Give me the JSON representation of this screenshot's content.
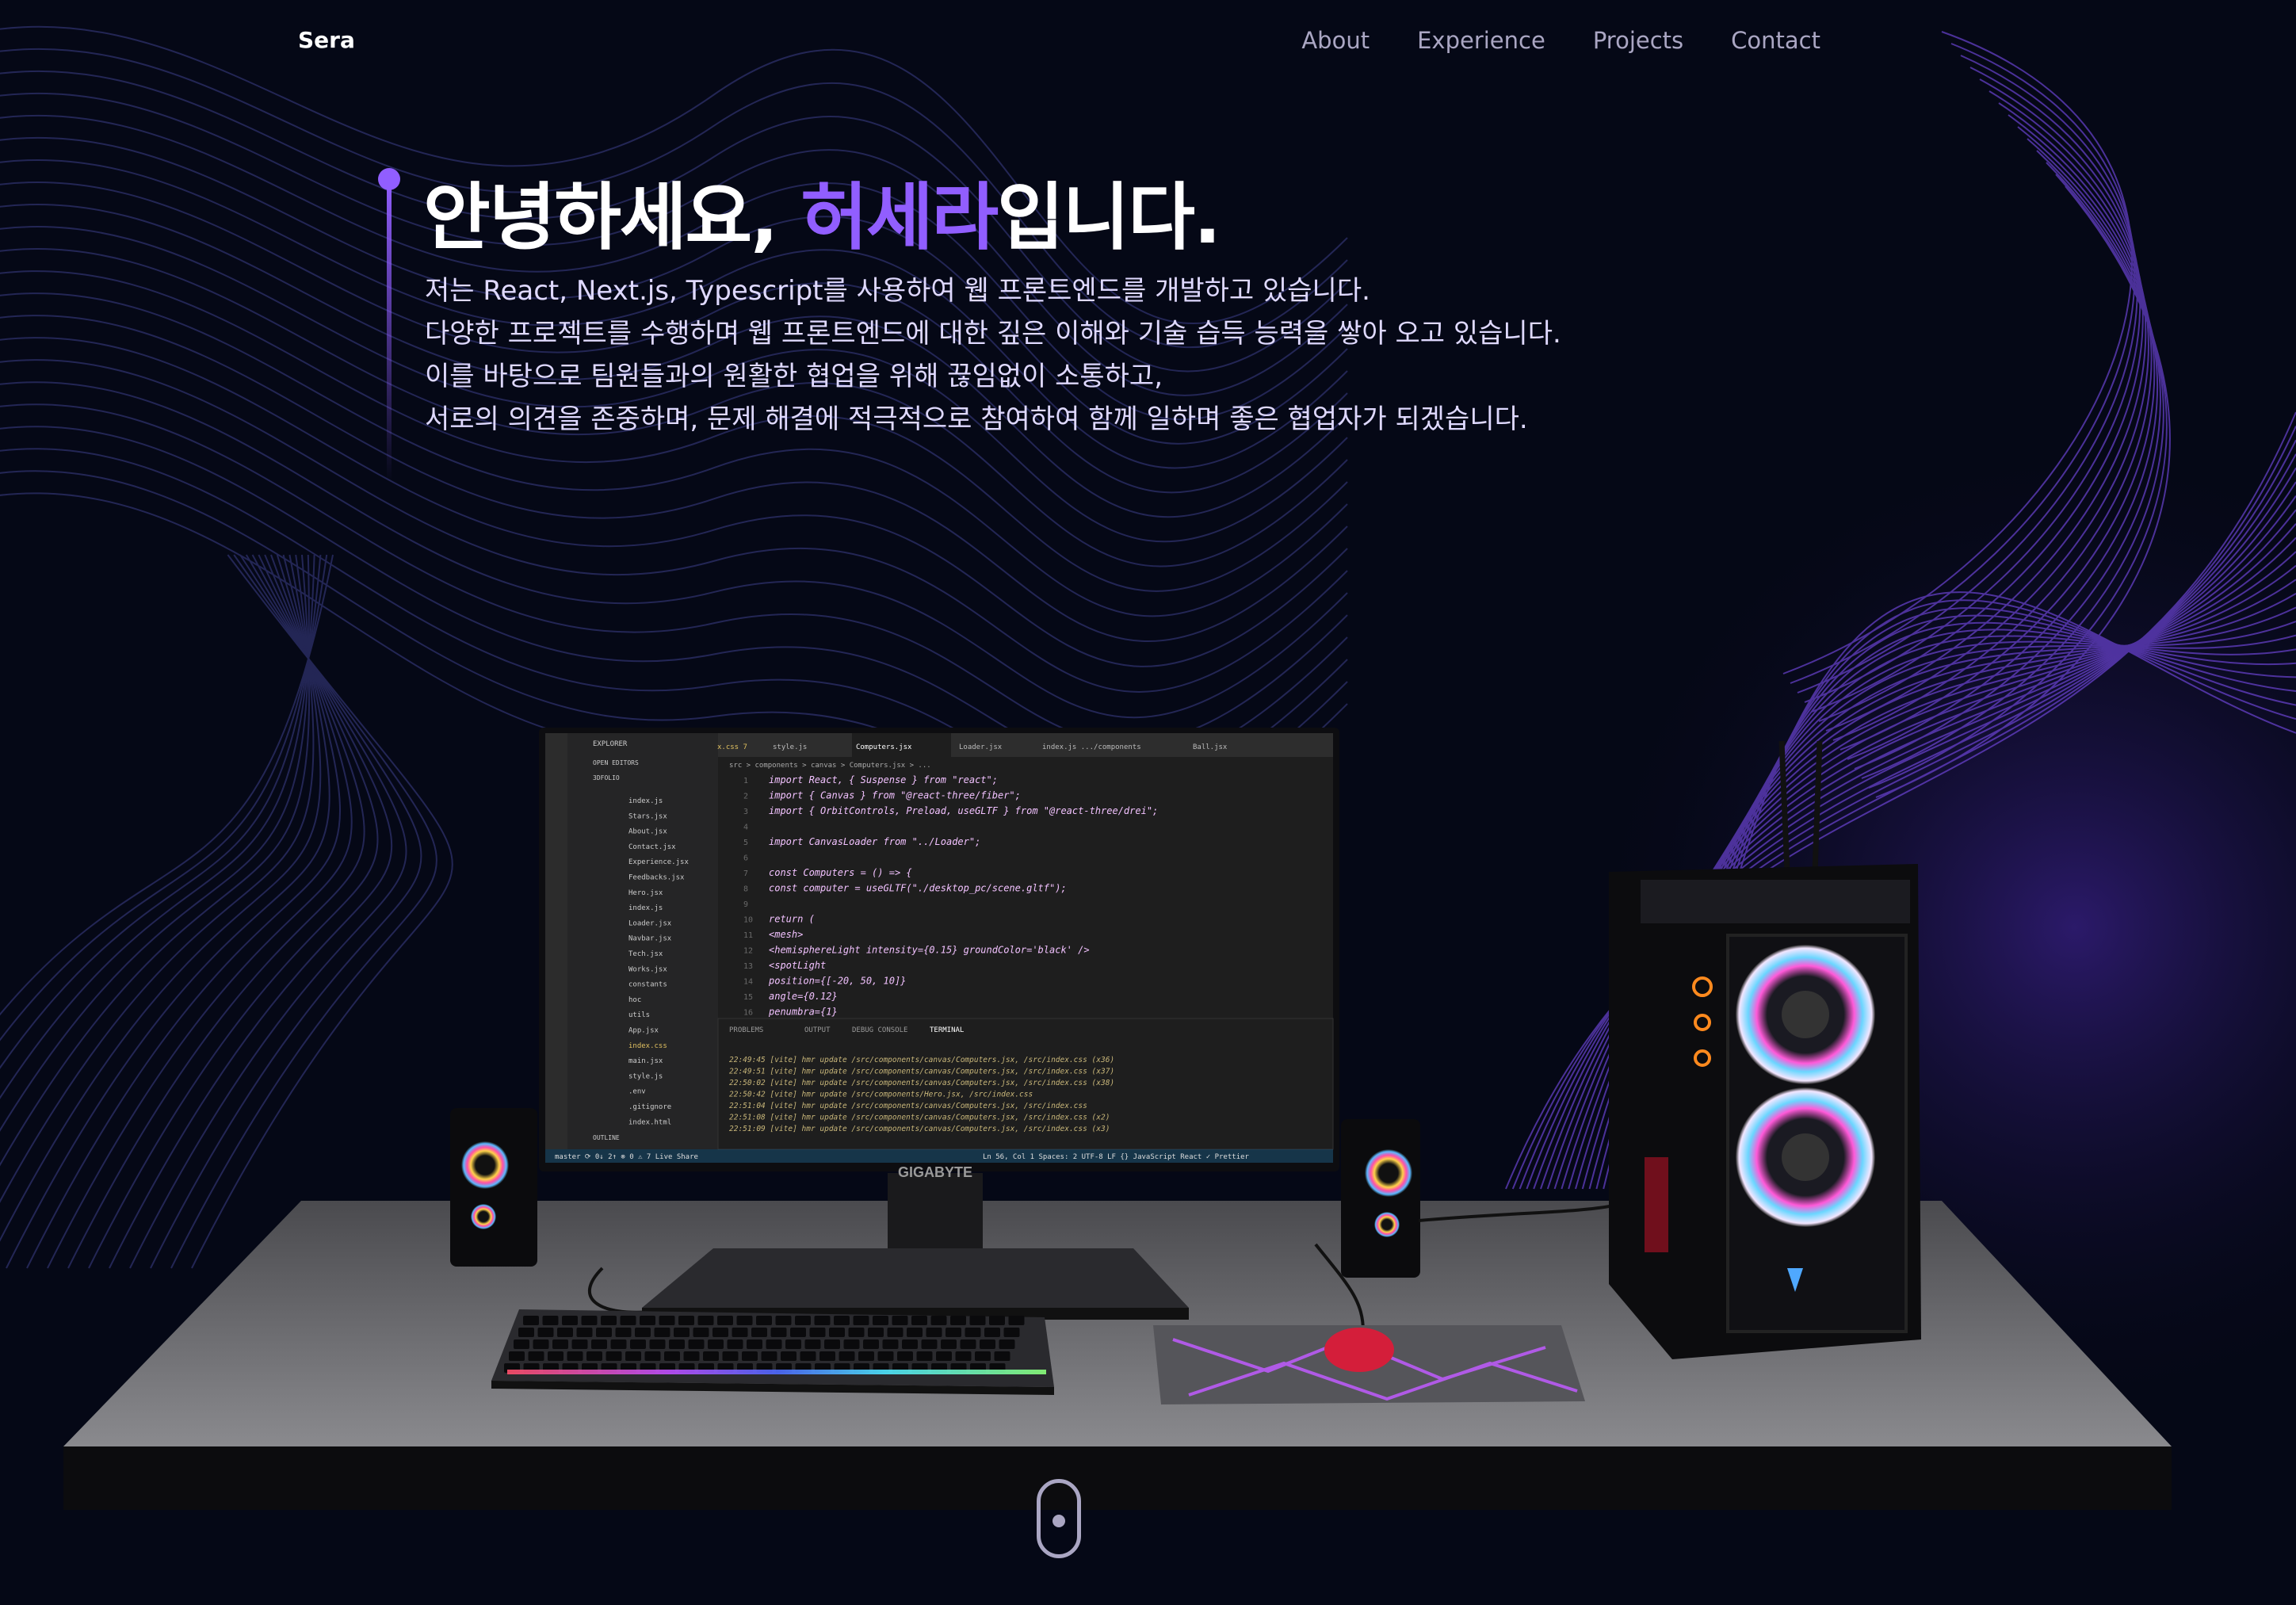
{
  "navbar": {
    "logo": "Sera",
    "links": [
      "About",
      "Experience",
      "Projects",
      "Contact"
    ]
  },
  "hero": {
    "title_prefix": "안녕하세요, ",
    "title_name": "허세라",
    "title_suffix": "입니다.",
    "description": [
      "저는 React, Next.js, Typescript를 사용하여 웹 프론트엔드를 개발하고 있습니다.",
      "다양한 프로젝트를 수행하며 웹 프론트엔드에 대한 깊은 이해와 기술 습득 능력을 쌓아 오고 있습니다.",
      "이를 바탕으로 팀원들과의 원활한 협업을 위해 끊임없이 소통하고,",
      "서로의 의견을 존중하며, 문제 해결에 적극적으로 참여하여 함께 일하며 좋은 협업자가 되겠습니다."
    ]
  },
  "editor": {
    "explorer_title": "EXPLORER",
    "open_editors": "OPEN EDITORS",
    "project": "3DFOLIO",
    "tabs": [
      "x.css 7",
      "style.js",
      "Computers.jsx",
      "Loader.jsx",
      "index.js .../components",
      "Ball.jsx"
    ],
    "breadcrumb": "src > components > canvas > Computers.jsx > ...",
    "files": [
      "index.js",
      "Stars.jsx",
      "About.jsx",
      "Contact.jsx",
      "Experience.jsx",
      "Feedbacks.jsx",
      "Hero.jsx",
      "index.js",
      "Loader.jsx",
      "Navbar.jsx",
      "Tech.jsx",
      "Works.jsx",
      "constants",
      "hoc",
      "utils",
      "App.jsx",
      "index.css",
      "main.jsx",
      "style.js",
      ".env",
      ".gitignore",
      "index.html"
    ],
    "outline": "OUTLINE",
    "code": [
      "import React, { Suspense } from \"react\";",
      "import { Canvas } from \"@react-three/fiber\";",
      "import { OrbitControls, Preload, useGLTF } from \"@react-three/drei\";",
      "",
      "import CanvasLoader from \"../Loader\";",
      "",
      "const Computers = () => {",
      "  const computer = useGLTF(\"./desktop_pc/scene.gltf\");",
      "",
      "  return (",
      "    <mesh>",
      "      <hemisphereLight intensity={0.15} groundColor='black' />",
      "      <spotLight",
      "        position={[-20, 50, 10]}",
      "        angle={0.12}",
      "        penumbra={1}"
    ],
    "line_numbers": [
      "1",
      "2",
      "3",
      "4",
      "5",
      "6",
      "7",
      "8",
      "9",
      "10",
      "11",
      "12",
      "13",
      "14",
      "15",
      "16"
    ],
    "panel_tabs": [
      "PROBLEMS",
      "OUTPUT",
      "DEBUG CONSOLE",
      "TERMINAL"
    ],
    "terminal": [
      "22:49:45 [vite] hmr update /src/components/canvas/Computers.jsx, /src/index.css (x36)",
      "22:49:51 [vite] hmr update /src/components/canvas/Computers.jsx, /src/index.css (x37)",
      "22:50:02 [vite] hmr update /src/components/canvas/Computers.jsx, /src/index.css (x38)",
      "22:50:42 [vite] hmr update /src/components/Hero.jsx, /src/index.css",
      "22:51:04 [vite] hmr update /src/components/canvas/Computers.jsx, /src/index.css",
      "22:51:08 [vite] hmr update /src/components/canvas/Computers.jsx, /src/index.css (x2)",
      "22:51:09 [vite] hmr update /src/components/canvas/Computers.jsx, /src/index.css (x3)"
    ],
    "status_left": "master  ⟳ 0↓ 2↑  ⊗ 0 ⚠ 7   Live Share",
    "status_right": "Ln 56, Col 1   Spaces: 2   UTF-8   LF   {} JavaScript React   ✓ Prettier",
    "monitor_brand": "GIGABYTE"
  },
  "colors": {
    "background": "#050816",
    "accent": "#915eff",
    "secondary_text": "#aaa6c3"
  },
  "scroll_indicator_icon": "mouse-scroll-icon"
}
